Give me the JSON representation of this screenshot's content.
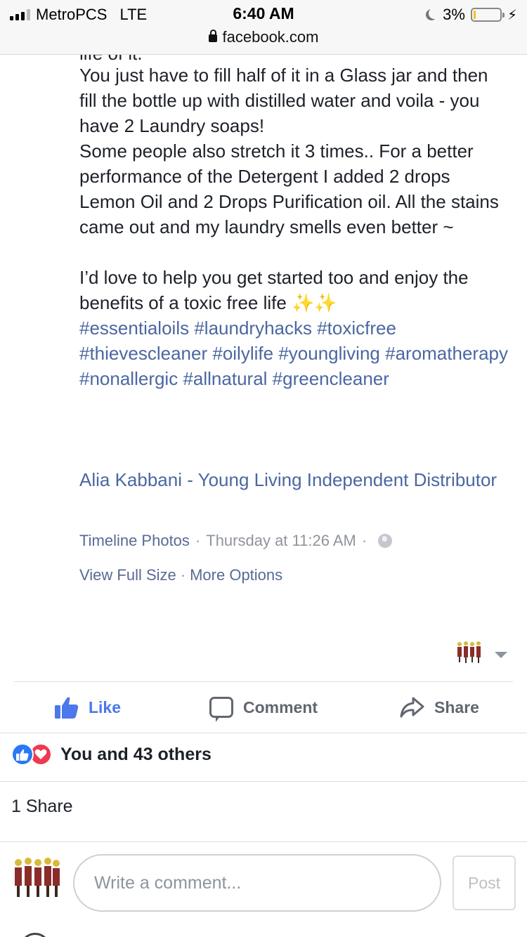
{
  "status_bar": {
    "carrier": "MetroPCS",
    "network": "LTE",
    "time": "6:40 AM",
    "battery_percent": "3%",
    "url": "facebook.com"
  },
  "post": {
    "cut_line": "life of it.",
    "paragraphs": [
      "You just have to fill half of it in a Glass jar and then fill the bottle up with distilled water and voila - you have 2 Laundry soaps!",
      "Some people also stretch it 3 times.. For a better performance of the Detergent I added 2 drops Lemon Oil and 2 Drops Purification oil. All the stains came out and my laundry smells even better ~"
    ],
    "closing_text": "I’d love to help you get started too and enjoy the benefits of a toxic free life ",
    "sparkles": "✨✨",
    "hashtags": [
      "#essentialoils",
      "#laundryhacks",
      "#toxicfree",
      "#thievescleaner",
      "#oilylife",
      "#youngliving",
      "#aromatherapy",
      "#nonallergic",
      "#allnatural",
      "#greencleaner"
    ],
    "author": "Alia Kabbani - Young Living Independent Distributor",
    "album": "Timeline Photos",
    "timestamp": "Thursday at 11:26 AM",
    "view_full_size": "View Full Size",
    "more_options": "More Options"
  },
  "actions": {
    "like": "Like",
    "comment": "Comment",
    "share": "Share"
  },
  "reactions": {
    "summary": "You and 43 others",
    "types": [
      "like",
      "love"
    ]
  },
  "shares": "1 Share",
  "composer": {
    "placeholder": "Write a comment...",
    "value": "",
    "post_label": "Post"
  },
  "colors": {
    "link": "#4b67a1",
    "like_blue": "#4b78ea",
    "love_red": "#f0384e",
    "text": "#1d2129",
    "muted": "#616770"
  }
}
